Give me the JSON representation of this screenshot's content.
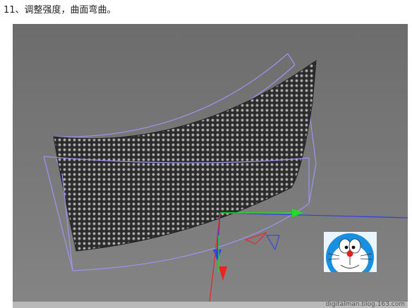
{
  "caption": {
    "text": "11、调整强度，曲面弯曲。"
  },
  "viewport": {
    "background": "#757575",
    "mesh_color": "#2b2b2b",
    "hole_color": "#8e8e8e",
    "bbox_color": "#9d94f2",
    "axis_colors": {
      "x": "#22dd22",
      "y": "#2f3fe8",
      "z": "#ee2222"
    }
  },
  "avatar": {
    "icon": "doraemon-face-icon"
  },
  "watermark": {
    "text": "digitalman.blog.163.com"
  }
}
